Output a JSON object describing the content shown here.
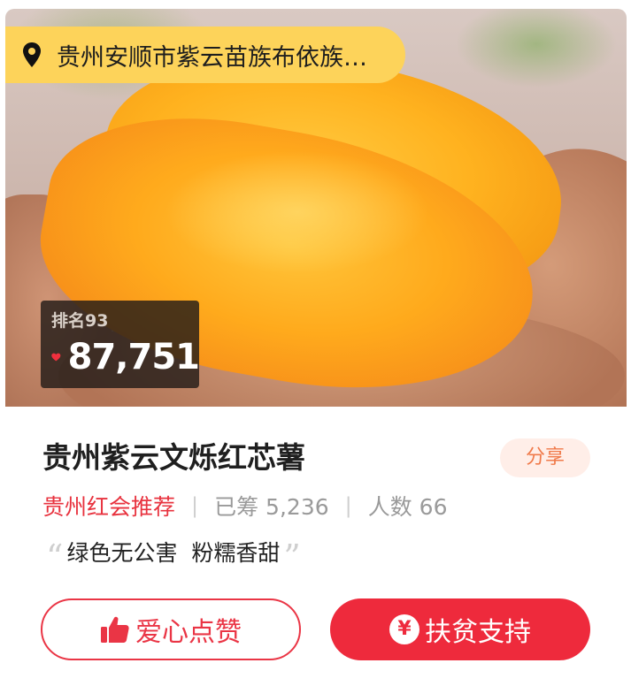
{
  "location": {
    "text": "贵州安顺市紫云苗族布依族…",
    "icon": "location-pin-icon"
  },
  "rank": {
    "label": "排名93",
    "like_count": "87,751",
    "icon": "heart-icon",
    "icon_color": "#f0303e"
  },
  "project": {
    "title": "贵州紫云文烁红芯薯",
    "share_label": "分享",
    "organizer": "贵州红会推荐",
    "raised_label": "已筹 5,236",
    "donors_label": "人数 66",
    "slogan_open_quote": "“",
    "slogan": "绿色无公害  粉糯香甜",
    "slogan_close_quote": "”"
  },
  "actions": {
    "like_label": "爱心点赞",
    "like_icon": "thumbs-up-icon",
    "support_label": "扶贫支持",
    "support_icon": "yen-icon",
    "support_icon_glyph": "¥"
  },
  "colors": {
    "accent_red": "#ee2a3c",
    "pill_yellow": "#fdd35a",
    "share_orange": "#f07a4a"
  }
}
